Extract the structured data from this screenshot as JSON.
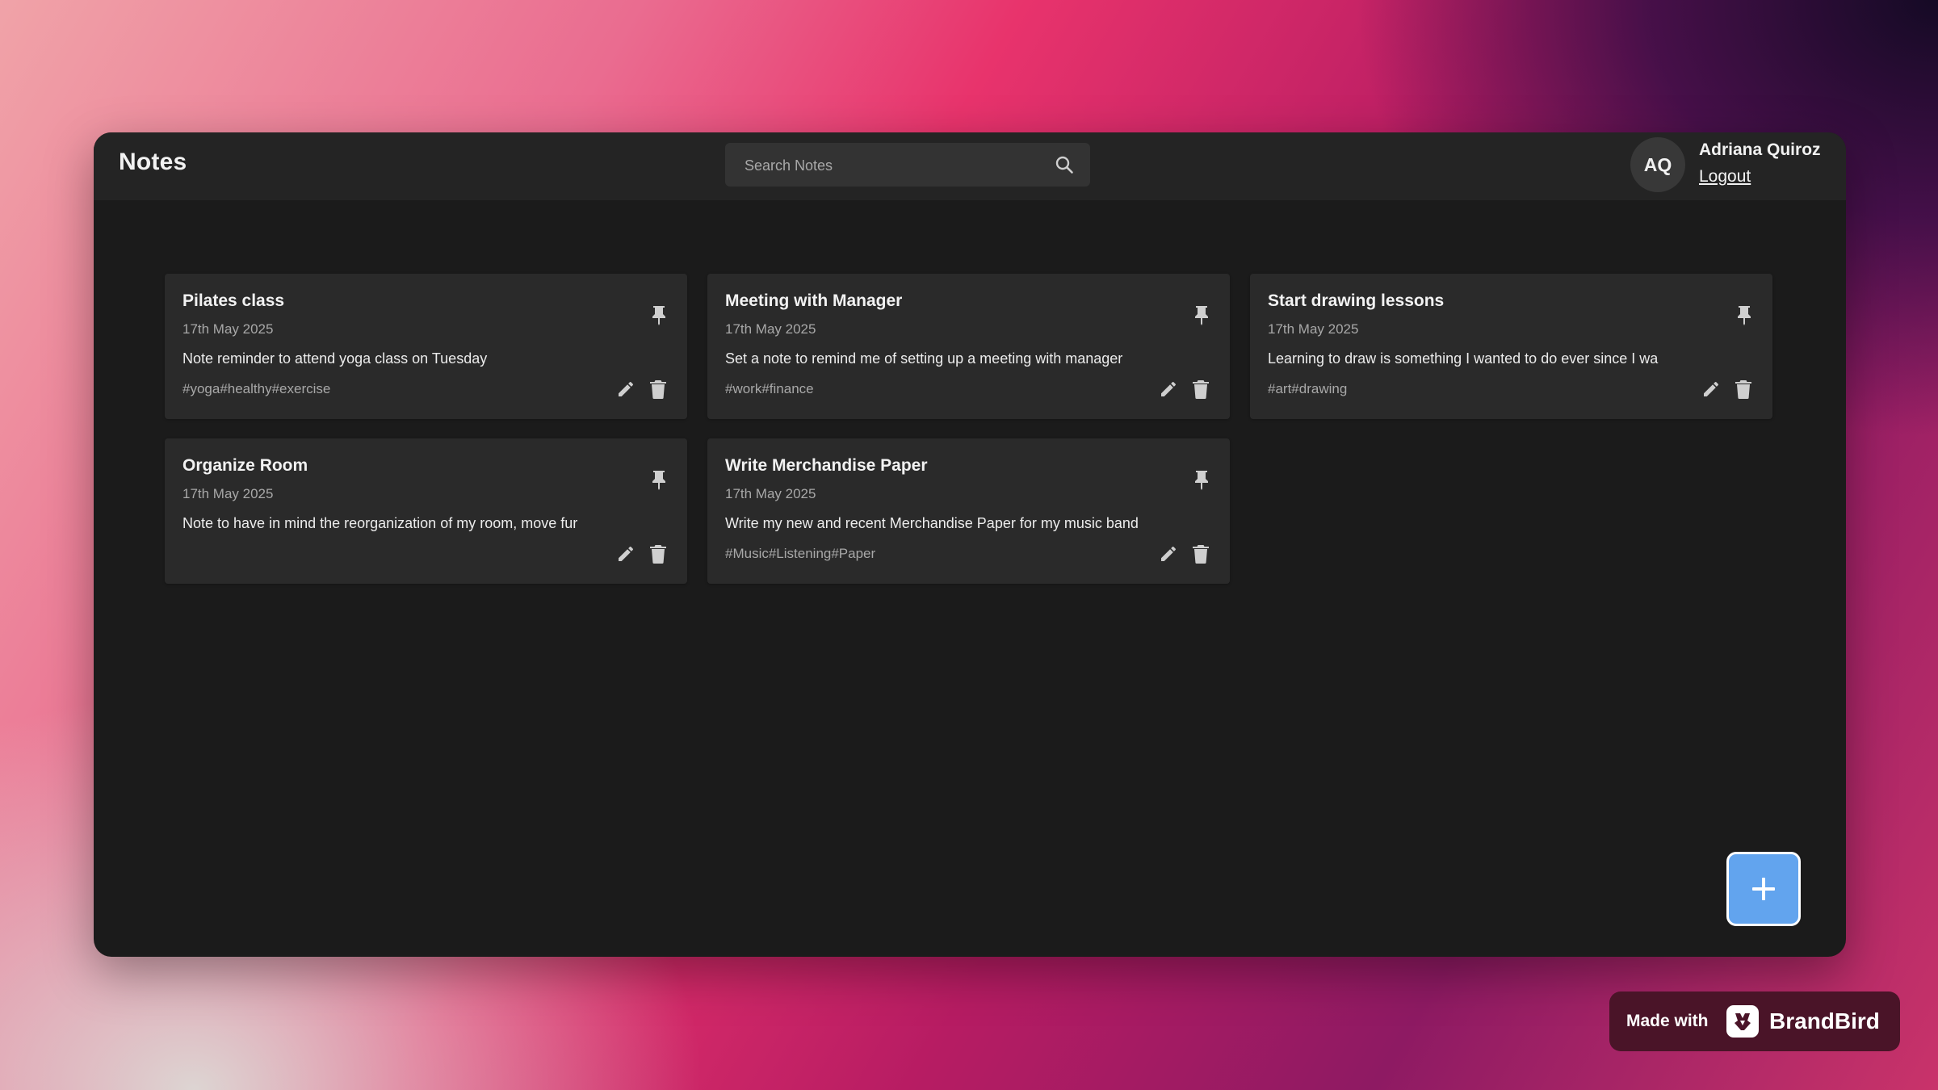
{
  "header": {
    "title": "Notes",
    "search": {
      "placeholder": "Search Notes",
      "value": ""
    },
    "user": {
      "initials": "AQ",
      "name": "Adriana Quiroz",
      "logout_label": "Logout"
    }
  },
  "notes": [
    {
      "title": "Pilates class",
      "date": "17th May 2025",
      "body": "Note reminder to attend yoga class on Tuesday",
      "tags": "#yoga#healthy#exercise"
    },
    {
      "title": "Meeting with Manager",
      "date": "17th May 2025",
      "body": "Set a note to remind me of setting up a meeting with manager",
      "tags": "#work#finance"
    },
    {
      "title": "Start drawing lessons",
      "date": "17th May 2025",
      "body": "Learning to draw is something I wanted to do ever since I wa",
      "tags": "#art#drawing"
    },
    {
      "title": "Organize Room",
      "date": "17th May 2025",
      "body": "Note to have in mind the reorganization of my room, move fur",
      "tags": ""
    },
    {
      "title": "Write Merchandise Paper",
      "date": "17th May 2025",
      "body": "Write my new and recent Merchandise Paper for my music band",
      "tags": "#Music#Listening#Paper"
    }
  ],
  "icons": {
    "search": "search-icon",
    "pin": "pin-icon",
    "edit": "pencil-icon",
    "delete": "trash-icon",
    "add": "plus-icon"
  },
  "colors": {
    "window_bg": "#1b1b1b",
    "header_bg": "#242424",
    "card_bg": "#2a2a2a",
    "accent": "#62a4ee"
  },
  "brand_badge": {
    "made_with": "Made with",
    "brand_name": "BrandBird"
  }
}
